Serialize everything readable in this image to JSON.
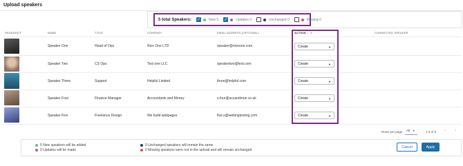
{
  "page": {
    "title": "Upload speakers"
  },
  "summary": {
    "title": "5 total Speakers:",
    "filters": [
      {
        "label": "New 5",
        "checked": true,
        "dot_color": "#6fbf73"
      },
      {
        "label": "Updates 0",
        "checked": true,
        "dot_color": "#a35db5"
      },
      {
        "label": "Unchanged 0",
        "checked": false,
        "dot_color": "#1f3b73"
      },
      {
        "label": "Missing 0",
        "checked": false,
        "dot_color": "#d9534f"
      }
    ]
  },
  "table": {
    "columns": {
      "headshot": "HEADSHOT",
      "name": "NAME",
      "title": "TITLE",
      "company": "COMPANY",
      "email": "EMAIL ADDRESS (OPTIONAL)",
      "action": "ACTION",
      "action_sort": "↓",
      "action_count": "5",
      "connected": "CONNECTED SPEAKER"
    },
    "rows": [
      {
        "name": "Speaker One",
        "title": "Head of Ops",
        "company": "Nice One LTD",
        "email": "speaker@niceone.com",
        "action": "Create",
        "avatar": "#3a3a3a"
      },
      {
        "name": "Speaker Two",
        "title": "CS Ops",
        "company": "Test one LLC",
        "email": "speakertwo@test.com",
        "action": "Create",
        "avatar": "#8a6f62"
      },
      {
        "name": "Speaker Three",
        "title": "Support",
        "company": "Helpful Limited",
        "email": "three@helpful.com",
        "action": "Create",
        "avatar": "#2f6f8a"
      },
      {
        "name": "Speaker Four",
        "title": "Finance Manager",
        "company": "Accountants and Money",
        "email": "s.four@accandmon.co.uk",
        "action": "Create",
        "avatar": "#7b6a5a"
      },
      {
        "name": "Speaker Five",
        "title": "Freelance Design",
        "company": "We build webpages",
        "email": "five.s@webingtesting.com",
        "action": "Create",
        "avatar": "#5a6fae"
      }
    ]
  },
  "pagination": {
    "rows_per_page_label": "Rows per page",
    "rows_per_page_value": "All",
    "range": "1-5 of 5",
    "prev": "‹",
    "next": "›"
  },
  "footer": {
    "legend": [
      {
        "text": "5 New speakers will be added",
        "dot_color": "#6fbf73"
      },
      {
        "text": "0 Updates will be made",
        "dot_color": "#a35db5"
      },
      {
        "text": "0 Unchanged speakers will remain the same",
        "dot_color": "#1f3b73"
      },
      {
        "text": "0 Missing speakers were not in the upload and will remain unchanged",
        "dot_color": "#d9534f"
      }
    ],
    "cancel_label": "Cancel",
    "apply_label": "Apply"
  }
}
